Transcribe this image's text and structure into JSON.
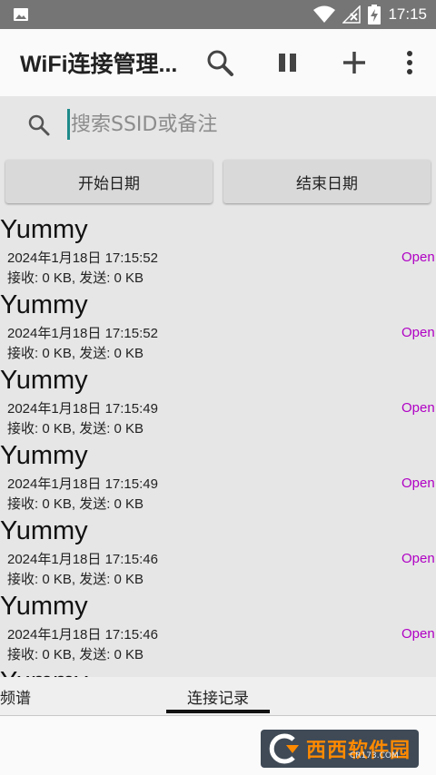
{
  "status_bar": {
    "time": "17:15"
  },
  "app_bar": {
    "title": "WiFi连接管理...",
    "icons": [
      "search-icon",
      "pause-icon",
      "add-icon",
      "more-vert-icon"
    ]
  },
  "search": {
    "placeholder": "搜索SSID或备注",
    "value": ""
  },
  "date_filters": {
    "start_label": "开始日期",
    "end_label": "结束日期"
  },
  "records": [
    {
      "ssid": "Yummy",
      "time": "2024年1月18日 17:15:52",
      "traffic": "接收: 0 KB, 发送: 0 KB",
      "security": "Open"
    },
    {
      "ssid": "Yummy",
      "time": "2024年1月18日 17:15:52",
      "traffic": "接收: 0 KB, 发送: 0 KB",
      "security": "Open"
    },
    {
      "ssid": "Yummy",
      "time": "2024年1月18日 17:15:49",
      "traffic": "接收: 0 KB, 发送: 0 KB",
      "security": "Open"
    },
    {
      "ssid": "Yummy",
      "time": "2024年1月18日 17:15:49",
      "traffic": "接收: 0 KB, 发送: 0 KB",
      "security": "Open"
    },
    {
      "ssid": "Yummy",
      "time": "2024年1月18日 17:15:46",
      "traffic": "接收: 0 KB, 发送: 0 KB",
      "security": "Open"
    },
    {
      "ssid": "Yummy",
      "time": "2024年1月18日 17:15:46",
      "traffic": "接收: 0 KB, 发送: 0 KB",
      "security": "Open"
    },
    {
      "ssid": "Yummy",
      "time": "",
      "traffic": "",
      "security": ""
    }
  ],
  "tabs": {
    "spectrum": "频谱",
    "records": "连接记录",
    "active": "records"
  },
  "watermark": {
    "text": "西西软件园",
    "sub": "CR173.COM"
  },
  "colors": {
    "accent": "#1f8a8a",
    "security": "#b000c4",
    "status_bar": "#757575"
  }
}
